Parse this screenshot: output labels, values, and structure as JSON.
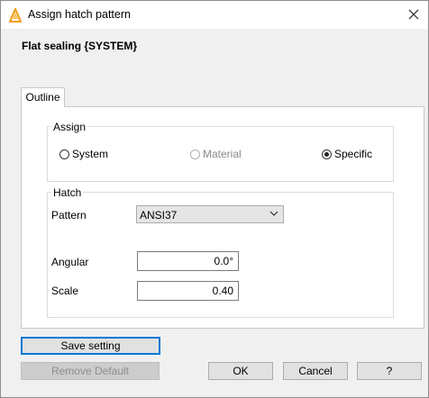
{
  "window": {
    "title": "Assign hatch pattern",
    "close_symbol": "✕"
  },
  "header": {
    "subtitle": "Flat sealing {SYSTEM}"
  },
  "tabs": [
    {
      "label": "Outline",
      "active": true
    }
  ],
  "assign_group": {
    "label": "Assign",
    "options": [
      {
        "label": "System",
        "selected": false,
        "enabled": true
      },
      {
        "label": "Material",
        "selected": false,
        "enabled": false
      },
      {
        "label": "Specific",
        "selected": true,
        "enabled": true
      }
    ]
  },
  "hatch_group": {
    "label": "Hatch",
    "pattern_label": "Pattern",
    "pattern_value": "ANSI37",
    "angular_label": "Angular",
    "angular_value": "0.0°",
    "scale_label": "Scale",
    "scale_value": "0.40"
  },
  "buttons": {
    "save_setting": "Save setting",
    "remove_default": "Remove Default",
    "ok": "OK",
    "cancel": "Cancel",
    "help": "?"
  },
  "colors": {
    "focus_border": "#0078d7",
    "app_icon": "#f0a020"
  },
  "icons": {
    "app": "app-logo-icon",
    "close": "close-icon",
    "dropdown": "chevron-down-icon"
  }
}
